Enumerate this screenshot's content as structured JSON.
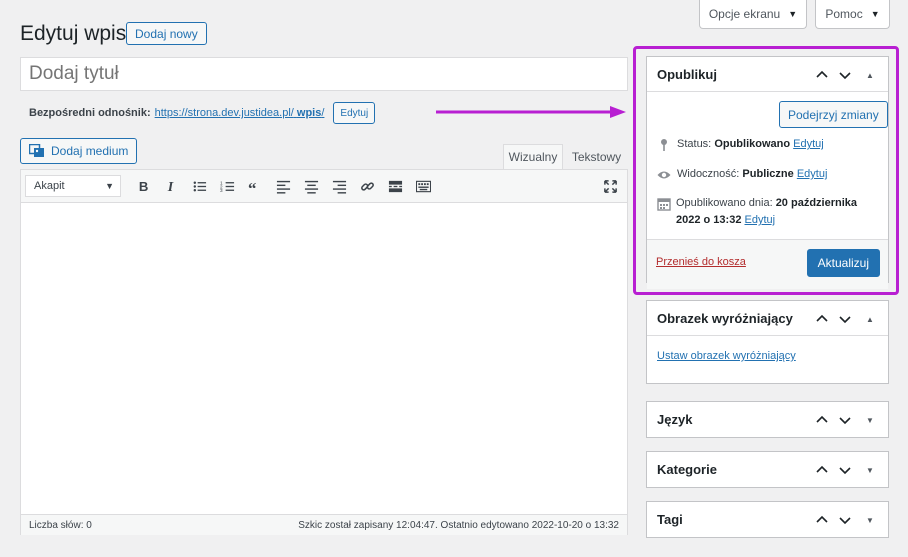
{
  "top": {
    "screen_options": "Opcje ekranu",
    "help": "Pomoc",
    "caret": "▼"
  },
  "header": {
    "title": "Edytuj wpis",
    "add_new": "Dodaj nowy"
  },
  "post": {
    "title_placeholder": "Dodaj tytuł",
    "permalink_label": "Bezpośredni odnośnik:",
    "permalink_base": "https://strona.dev.justidea.pl/",
    "permalink_slug": "wpis",
    "permalink_slash": "/",
    "permalink_edit": "Edytuj"
  },
  "editor": {
    "add_media": "Dodaj medium",
    "tab_visual": "Wizualny",
    "tab_text": "Tekstowy",
    "format": "Akapit",
    "tools": [
      "bold-icon",
      "italic-icon",
      "bullet-list-icon",
      "numbered-list-icon",
      "quote-icon",
      "align-left-icon",
      "align-center-icon",
      "align-right-icon",
      "link-icon",
      "read-more-icon",
      "toolbar-toggle-icon"
    ],
    "word_count": "Liczba słów: 0",
    "save_status": "Szkic został zapisany 12:04:47. Ostatnio edytowano 2022-10-20 o 13:32"
  },
  "publish": {
    "title": "Opublikuj",
    "preview": "Podejrzyj zmiany",
    "status_label": "Status:",
    "status_value": "Opublikowano",
    "visibility_label": "Widoczność:",
    "visibility_value": "Publiczne",
    "published_label": "Opublikowano dnia:",
    "published_value": "20 października 2022 o 13:32",
    "edit": "Edytuj",
    "trash": "Przenieś do kosza",
    "update": "Aktualizuj"
  },
  "featured": {
    "title": "Obrazek wyróżniający",
    "set_link": "Ustaw obrazek wyróżniający"
  },
  "language": {
    "title": "Język"
  },
  "categories": {
    "title": "Kategorie"
  },
  "tags": {
    "title": "Tagi"
  },
  "colors": {
    "accent": "#2271b1",
    "highlight": "#b81fd2",
    "danger": "#b32d2e"
  }
}
